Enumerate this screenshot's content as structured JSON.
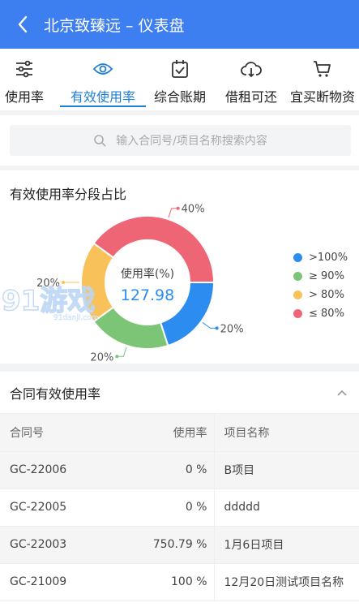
{
  "header": {
    "title": "北京致臻远 – 仪表盘"
  },
  "tabs": [
    {
      "label": "使用率",
      "icon": "sliders-icon"
    },
    {
      "label": "有效使用率",
      "icon": "eye-icon",
      "active": true
    },
    {
      "label": "综合账期",
      "icon": "calendar-check-icon"
    },
    {
      "label": "借租可还",
      "icon": "cloud-download-icon"
    },
    {
      "label": "宜买断物资",
      "icon": "cart-icon"
    }
  ],
  "search": {
    "placeholder": "输入合同号/项目名称搜索内容"
  },
  "chart": {
    "title": "有效使用率分段占比",
    "center_label": "使用率(%)",
    "center_value": "127.98",
    "watermark": {
      "text": "91游戏",
      "sub": "91danji.com"
    }
  },
  "chart_data": {
    "type": "pie",
    "slices": [
      {
        "label": ">100%",
        "value": 20,
        "color": "#2d8cf0"
      },
      {
        "label": "≥ 90%",
        "value": 20,
        "color": "#7cc576"
      },
      {
        "label": "> 80%",
        "value": 20,
        "color": "#f9c15a"
      },
      {
        "label": "≤ 80%",
        "value": 40,
        "color": "#ee6675"
      }
    ],
    "data_labels": [
      "20%",
      "20%",
      "20%",
      "40%"
    ],
    "legend": "right"
  },
  "table": {
    "title": "合同有效使用率",
    "headers": [
      "合同号",
      "使用率",
      "项目名称"
    ],
    "rows": [
      [
        "GC-22006",
        "0 %",
        "B项目"
      ],
      [
        "GC-22005",
        "0 %",
        "ddddd"
      ],
      [
        "GC-22003",
        "750.79 %",
        "1月6日项目"
      ],
      [
        "GC-21009",
        "100 %",
        "12月20日测试项目名称"
      ]
    ]
  }
}
